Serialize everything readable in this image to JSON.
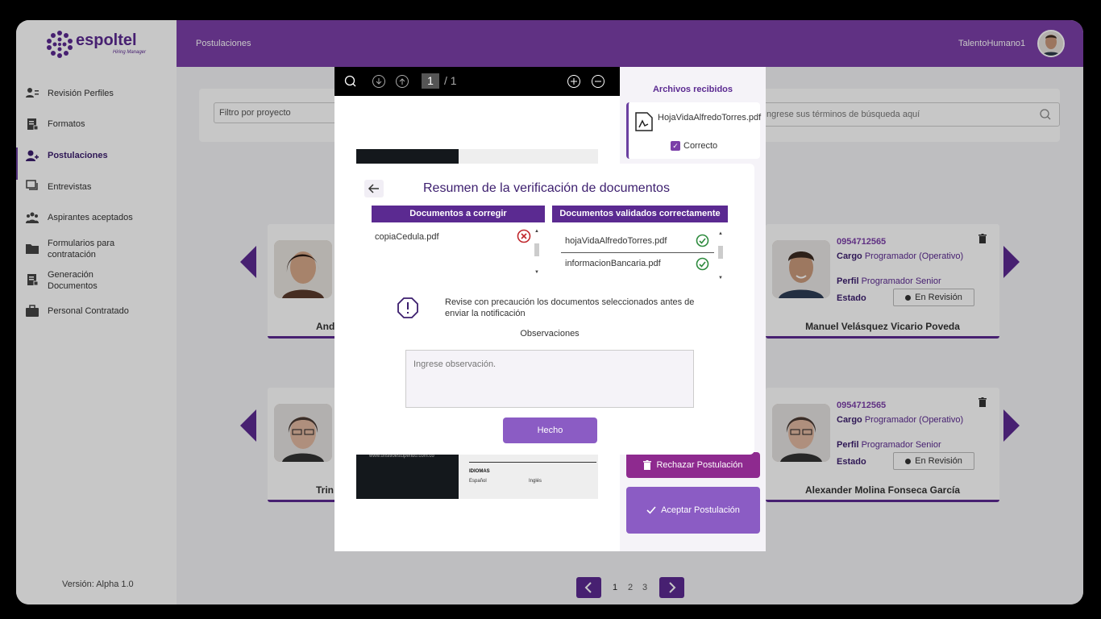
{
  "brand": {
    "name": "espoltel",
    "tagline": "Hiring Manager"
  },
  "sidebar": {
    "items": [
      {
        "label": "Revisión Perfiles",
        "icon": "user-list-icon"
      },
      {
        "label": "Formatos",
        "icon": "document-icon"
      },
      {
        "label": "Postulaciones",
        "icon": "user-add-icon",
        "active": true
      },
      {
        "label": "Entrevistas",
        "icon": "chat-icon"
      },
      {
        "label": "Aspirantes aceptados",
        "icon": "group-icon"
      },
      {
        "label": "Formularios para contratación",
        "icon": "folder-icon"
      },
      {
        "label": "Generación Documentos",
        "icon": "document-icon"
      },
      {
        "label": "Personal Contratado",
        "icon": "briefcase-icon"
      }
    ],
    "version": "Versión: Alpha 1.0"
  },
  "header": {
    "title": "Postulaciones",
    "user": "TalentoHumano1"
  },
  "filters": {
    "project_placeholder": "Filtro por proyecto",
    "search_placeholder": "Ingrese sus términos de búsqueda aquí"
  },
  "cards": [
    {
      "phone": "0954712565",
      "cargo_label": "Cargo",
      "cargo": "Programador (Operativo)",
      "perfil_label": "Perfil",
      "perfil": "Programador Senior",
      "estado_label": "Estado",
      "estado": "En Revisión",
      "name": "Manuel Velásquez Vicario Poveda"
    },
    {
      "phone": "0954712565",
      "cargo_label": "Cargo",
      "cargo": "Programador (Operativo)",
      "perfil_label": "Perfil",
      "perfil": "Programador Senior",
      "estado_label": "Estado",
      "estado": "En Revisión",
      "name": "Alexander Molina Fonseca García"
    }
  ],
  "partial_names": [
    "And",
    "Trin"
  ],
  "pagination": {
    "pages": [
      "1",
      "2",
      "3"
    ],
    "current": "1"
  },
  "viewer": {
    "page_current": "1",
    "page_total": "/ 1",
    "doc_url": "www.unsitioestupendo.com.co",
    "doc_section": "IDIOMAS",
    "doc_lang1": "Español",
    "doc_lang2": "Inglés",
    "files_title": "Archivos recibidos",
    "file_name": "HojaVidaAlfredoTorres.pdf",
    "file_status": "Correcto",
    "reject_label": "Rechazar Postulación",
    "accept_label": "Aceptar Postulación"
  },
  "modal": {
    "title": "Resumen de la verificación de documentos",
    "col_correct_title": "Documentos a corregir",
    "col_valid_title": "Documentos validados correctamente",
    "to_correct": [
      "copiaCedula.pdf"
    ],
    "validated": [
      "hojaVidaAlfredoTorres.pdf",
      "informacionBancaria.pdf"
    ],
    "warning": "Revise con precaución los documentos seleccionados antes de enviar la notificación",
    "obs_label": "Observaciones",
    "obs_placeholder": "Ingrese observación.",
    "done_label": "Hecho"
  },
  "colors": {
    "primary": "#5b2a91",
    "topbar": "#7b3fa8",
    "reject": "#8e2a8f",
    "accept": "#8b5cc4",
    "error": "#c0282d",
    "success": "#2e8b3e"
  }
}
